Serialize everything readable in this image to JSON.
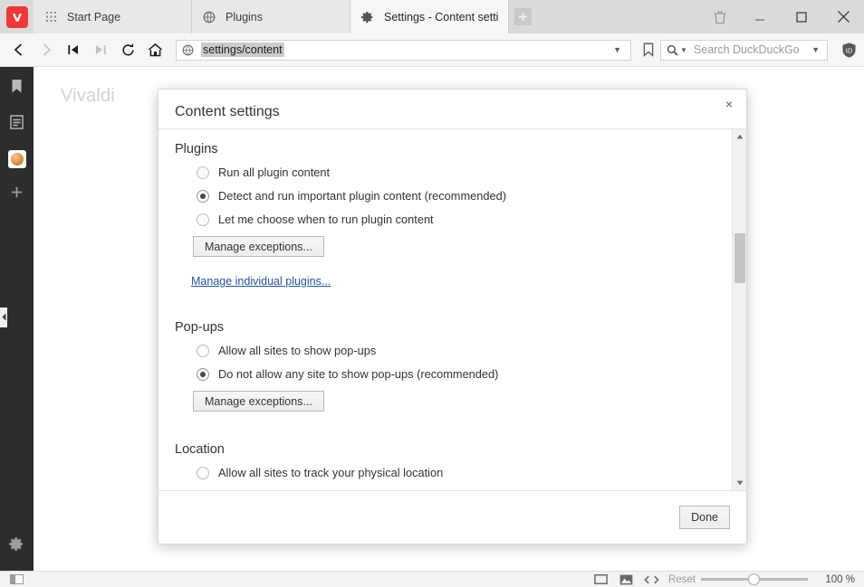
{
  "browser": {
    "name": "Vivaldi",
    "watermark": "Vivaldi"
  },
  "tabbar": {
    "logo_icon": "vivaldi-logo-icon",
    "tabs": [
      {
        "label": "Start Page",
        "icon": "grid-icon",
        "active": false
      },
      {
        "label": "Plugins",
        "icon": "globe-icon",
        "active": false
      },
      {
        "label": "Settings - Content settings",
        "icon": "gear-icon",
        "active": true
      }
    ],
    "new_tab_label": "+",
    "window_controls": [
      {
        "name": "trash-icon",
        "label": ""
      },
      {
        "name": "minimize-icon",
        "label": ""
      },
      {
        "name": "maximize-icon",
        "label": ""
      },
      {
        "name": "close-icon",
        "label": ""
      }
    ]
  },
  "toolbar": {
    "back_icon": "back-arrow-icon",
    "forward_icon": "forward-arrow-icon",
    "rewind_icon": "rewind-icon",
    "fastforward_icon": "fast-forward-icon",
    "reload_icon": "reload-icon",
    "home_icon": "home-icon",
    "address": {
      "value": "settings/content",
      "placeholder": "",
      "site_icon": "globe-icon",
      "dropdown_caret": "▼"
    },
    "bookmark_icon": "bookmark-icon",
    "search": {
      "placeholder": "Search DuckDuckGo",
      "engine_icon": "magnifier-icon",
      "engine_caret": "▼",
      "dropdown_caret": "▼"
    },
    "extension_icon": "shield-extension-icon"
  },
  "sidebar": {
    "items": [
      {
        "name": "sidebar-item-bookmarks",
        "icon": "bookmark-icon"
      },
      {
        "name": "sidebar-item-notes",
        "icon": "notes-icon"
      },
      {
        "name": "sidebar-item-web-panel",
        "icon": "web-panel-icon"
      },
      {
        "name": "sidebar-item-add-panel",
        "icon": "plus-icon"
      }
    ],
    "settings": {
      "name": "sidebar-item-settings",
      "icon": "gear-icon"
    },
    "collapse_handle_icon": "chevron-left-icon"
  },
  "dialog": {
    "title": "Content settings",
    "close_label": "×",
    "done_label": "Done",
    "sections": [
      {
        "heading": "Plugins",
        "options": [
          {
            "label": "Run all plugin content",
            "checked": false
          },
          {
            "label": "Detect and run important plugin content (recommended)",
            "checked": true
          },
          {
            "label": "Let me choose when to run plugin content",
            "checked": false
          }
        ],
        "button": "Manage exceptions...",
        "link": "Manage individual plugins..."
      },
      {
        "heading": "Pop-ups",
        "options": [
          {
            "label": "Allow all sites to show pop-ups",
            "checked": false
          },
          {
            "label": "Do not allow any site to show pop-ups (recommended)",
            "checked": true
          }
        ],
        "button": "Manage exceptions...",
        "link": ""
      },
      {
        "heading": "Location",
        "options": [
          {
            "label": "Allow all sites to track your physical location",
            "checked": false
          }
        ],
        "button": "",
        "link": ""
      }
    ],
    "scrollbar": {
      "up_arrow": "▲",
      "down_arrow": "▼"
    }
  },
  "statusbar": {
    "panel_toggle_icon": "panel-toggle-icon",
    "tiling_icon": "tiling-icon",
    "images_icon": "images-icon",
    "code_icon": "code-icon",
    "reset_label": "Reset",
    "zoom_value": "100 %"
  },
  "colors": {
    "accent": "#ef3939",
    "sidebar_bg": "#2d2d2d",
    "tabbar_bg": "#dadada",
    "link": "#2952a3"
  }
}
